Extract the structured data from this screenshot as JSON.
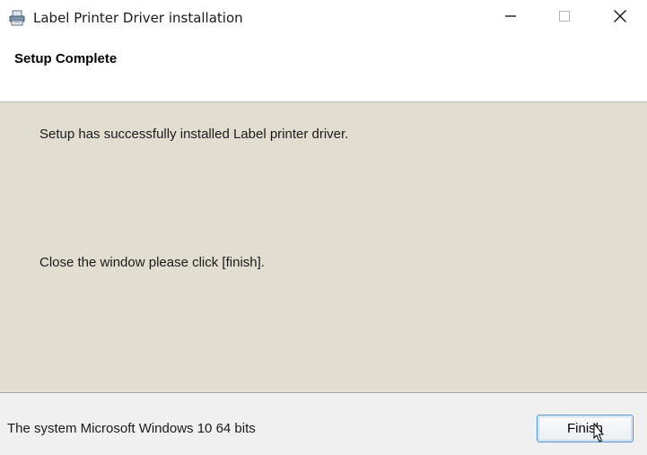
{
  "window": {
    "title": "Label Printer Driver installation",
    "icon": "printer-icon",
    "controls": {
      "minimize_icon": "minimize-icon",
      "maximize_icon": "maximize-icon",
      "close_icon": "close-icon"
    }
  },
  "header": {
    "title": "Setup Complete"
  },
  "content": {
    "message_success": "Setup has successfully installed Label printer driver.",
    "message_close": "Close the window please click [finish]."
  },
  "footer": {
    "system_info": "The system Microsoft Windows 10 64 bits",
    "finish_label": "Finish"
  },
  "colors": {
    "content_background": "#e1ded1",
    "footer_background": "#f0f0f0",
    "button_focus_border": "#4a8fd6"
  }
}
